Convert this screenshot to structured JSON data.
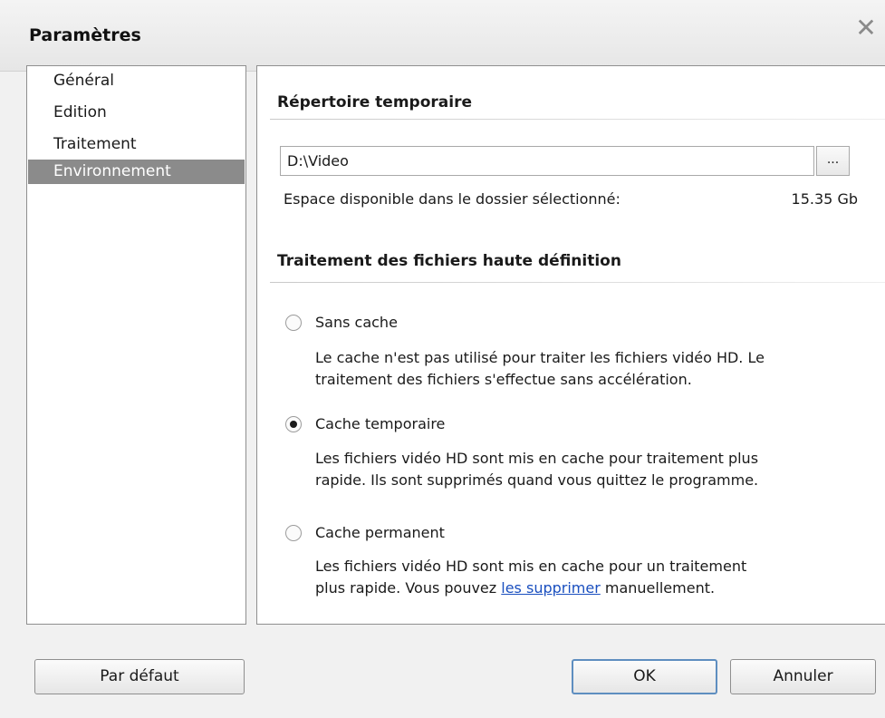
{
  "window": {
    "title": "Paramètres",
    "close_glyph": "✕"
  },
  "nav": {
    "items": [
      {
        "label": "Général",
        "selected": false
      },
      {
        "label": "Edition",
        "selected": false
      },
      {
        "label": "Traitement",
        "selected": false
      },
      {
        "label": "Environnement",
        "selected": true
      }
    ]
  },
  "temp_dir": {
    "heading": "Répertoire temporaire",
    "path_value": "D:\\Video",
    "browse_label": "...",
    "space_label": "Espace disponible dans le dossier sélectionné:",
    "space_value": "15.35 Gb"
  },
  "hd": {
    "heading": "Traitement des fichiers haute définition",
    "options": [
      {
        "label": "Sans cache",
        "checked": false,
        "desc_line1": "Le cache n'est pas utilisé pour traiter les fichiers vidéo HD. Le",
        "desc_line2": "traitement des fichiers s'effectue sans accélération."
      },
      {
        "label": "Cache temporaire",
        "checked": true,
        "desc_line1": "Les fichiers vidéo HD sont mis en cache pour traitement plus",
        "desc_line2": "rapide. Ils sont supprimés quand vous quittez le programme."
      },
      {
        "label": "Cache permanent",
        "checked": false,
        "desc_line1": "Les fichiers vidéo HD sont mis en cache pour un traitement",
        "desc_line2_before": "plus rapide. Vous pouvez ",
        "desc_link": "les supprimer",
        "desc_line2_after": " manuellement."
      }
    ]
  },
  "footer": {
    "default_label": "Par défaut",
    "ok_label": "OK",
    "cancel_label": "Annuler"
  },
  "colors": {
    "selection": "#8b8b8b",
    "link": "#1a4fbf",
    "default_button_border": "#5e8ec0"
  }
}
